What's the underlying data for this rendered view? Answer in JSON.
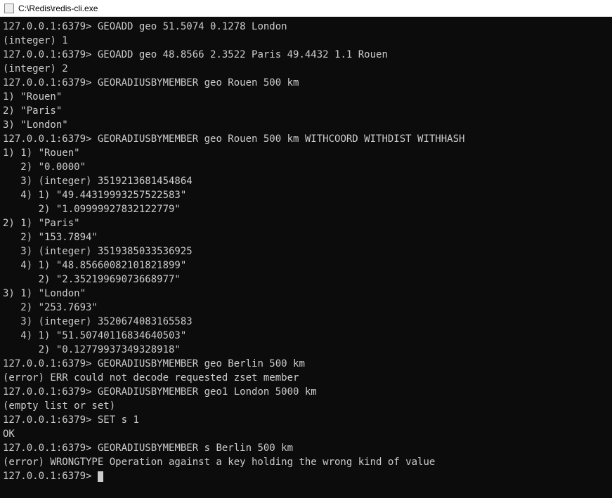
{
  "window": {
    "title": "C:\\Redis\\redis-cli.exe"
  },
  "terminal": {
    "lines": [
      {
        "prompt": "127.0.0.1:6379>",
        "cmd": " GEOADD geo 51.5074 0.1278 London"
      },
      {
        "text": "(integer) 1"
      },
      {
        "prompt": "127.0.0.1:6379>",
        "cmd": " GEOADD geo 48.8566 2.3522 Paris 49.4432 1.1 Rouen"
      },
      {
        "text": "(integer) 2"
      },
      {
        "prompt": "127.0.0.1:6379>",
        "cmd": " GEORADIUSBYMEMBER geo Rouen 500 km"
      },
      {
        "text": "1) \"Rouen\""
      },
      {
        "text": "2) \"Paris\""
      },
      {
        "text": "3) \"London\""
      },
      {
        "prompt": "127.0.0.1:6379>",
        "cmd": " GEORADIUSBYMEMBER geo Rouen 500 km WITHCOORD WITHDIST WITHHASH"
      },
      {
        "text": "1) 1) \"Rouen\""
      },
      {
        "text": "   2) \"0.0000\""
      },
      {
        "text": "   3) (integer) 3519213681454864"
      },
      {
        "text": "   4) 1) \"49.44319993257522583\""
      },
      {
        "text": "      2) \"1.09999927832122779\""
      },
      {
        "text": "2) 1) \"Paris\""
      },
      {
        "text": "   2) \"153.7894\""
      },
      {
        "text": "   3) (integer) 3519385033536925"
      },
      {
        "text": "   4) 1) \"48.85660082101821899\""
      },
      {
        "text": "      2) \"2.35219969073668977\""
      },
      {
        "text": "3) 1) \"London\""
      },
      {
        "text": "   2) \"253.7693\""
      },
      {
        "text": "   3) (integer) 3520674083165583"
      },
      {
        "text": "   4) 1) \"51.50740116834640503\""
      },
      {
        "text": "      2) \"0.12779937349328918\""
      },
      {
        "prompt": "127.0.0.1:6379>",
        "cmd": " GEORADIUSBYMEMBER geo Berlin 500 km"
      },
      {
        "text": "(error) ERR could not decode requested zset member"
      },
      {
        "prompt": "127.0.0.1:6379>",
        "cmd": " GEORADIUSBYMEMBER geo1 London 5000 km"
      },
      {
        "text": "(empty list or set)"
      },
      {
        "prompt": "127.0.0.1:6379>",
        "cmd": " SET s 1"
      },
      {
        "text": "OK"
      },
      {
        "prompt": "127.0.0.1:6379>",
        "cmd": " GEORADIUSBYMEMBER s Berlin 500 km"
      },
      {
        "text": "(error) WRONGTYPE Operation against a key holding the wrong kind of value"
      },
      {
        "prompt": "127.0.0.1:6379>",
        "cmd": " ",
        "cursor": true
      }
    ]
  }
}
